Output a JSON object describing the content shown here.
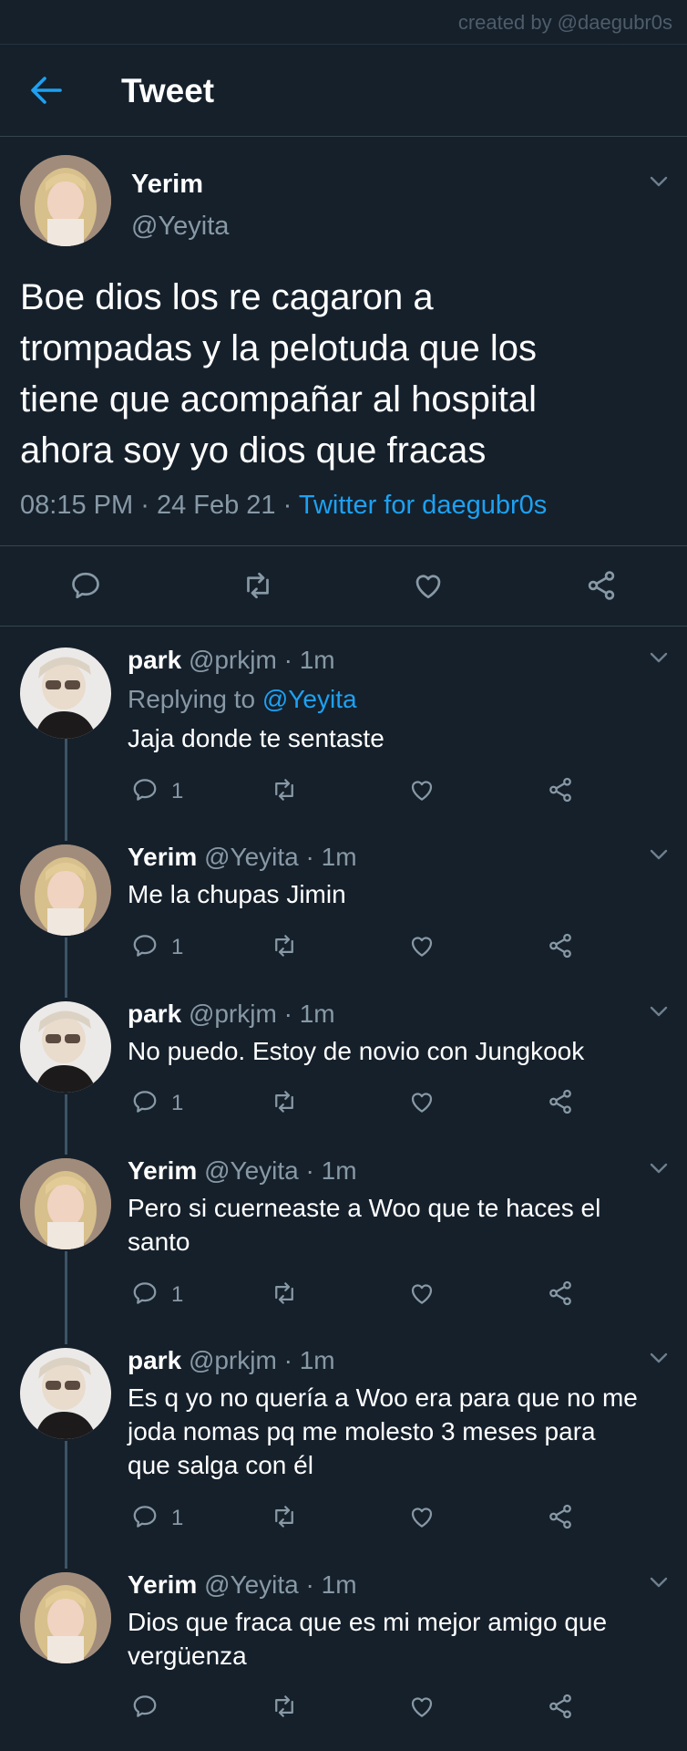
{
  "credit": "created by @daegubr0s",
  "header": {
    "title": "Tweet"
  },
  "colors": {
    "background": "#15202b",
    "accent": "#1da1f2",
    "muted": "#8899a6",
    "divider": "#38444d"
  },
  "main_tweet": {
    "name": "Yerim",
    "handle": "@Yeyita",
    "lines": [
      "Boe dios los re cagaron a",
      "trompadas y la pelotuda que los",
      "tiene que acompañar al hospital",
      "ahora soy yo  dios que fracas"
    ],
    "time": "08:15 PM",
    "sep": "·",
    "date": "24 Feb 21",
    "source": "Twitter for daegubr0s"
  },
  "replies": [
    {
      "name": "park",
      "handle": "@prkjm",
      "dot": "·",
      "time": "1m",
      "replying_label": "Replying to",
      "replying_to": "@Yeyita",
      "lines": [
        "Jaja donde te sentaste"
      ],
      "reply_count": "1"
    },
    {
      "name": "Yerim",
      "handle": "@Yeyita",
      "dot": "·",
      "time": "1m",
      "lines": [
        "Me la chupas Jimin"
      ],
      "reply_count": "1"
    },
    {
      "name": "park",
      "handle": "@prkjm",
      "dot": "·",
      "time": "1m",
      "lines": [
        "No puedo. Estoy de novio con Jungkook"
      ],
      "reply_count": "1"
    },
    {
      "name": "Yerim",
      "handle": "@Yeyita",
      "dot": "·",
      "time": "1m",
      "lines": [
        "Pero si cuerneaste a Woo que te haces el",
        "santo"
      ],
      "reply_count": "1"
    },
    {
      "name": "park",
      "handle": "@prkjm",
      "dot": "·",
      "time": "1m",
      "lines": [
        "Es q yo no quería a Woo era para que no me",
        "joda nomas pq me molesto 3 meses para",
        "que salga con él"
      ],
      "reply_count": "1"
    },
    {
      "name": "Yerim",
      "handle": "@Yeyita",
      "dot": "·",
      "time": "1m",
      "lines": [
        "Dios que fraca que es mi mejor amigo que",
        "vergüenza"
      ],
      "reply_count": ""
    }
  ],
  "icons": {
    "back": "arrow-left-icon",
    "reply": "comment-icon",
    "retweet": "retweet-icon",
    "like": "heart-icon",
    "share": "share-icon",
    "more": "chevron-down-icon"
  }
}
